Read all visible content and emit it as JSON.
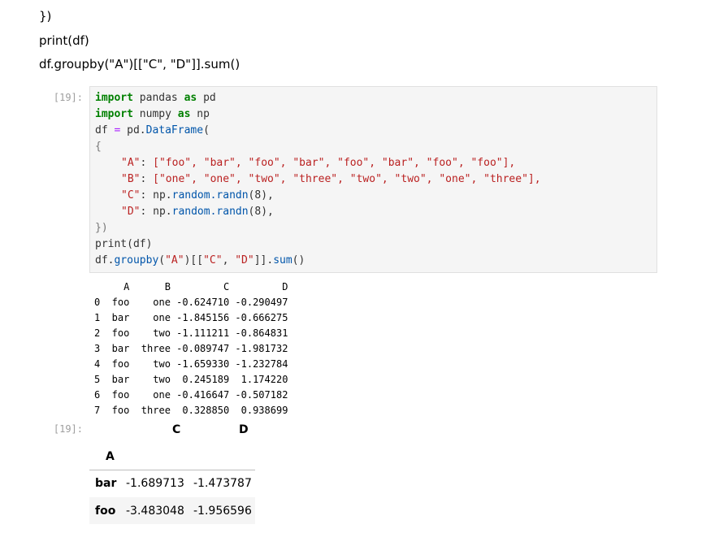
{
  "markdown_lines": [
    "})",
    "print(df)",
    "df.groupby(\"A\")[[\"C\", \"D\"]].sum()"
  ],
  "input_prompt": "[19]:",
  "output_prompt": "[19]:",
  "code": {
    "l1_kw1": "import",
    "l1_mid": " pandas ",
    "l1_kw2": "as",
    "l1_end": " pd",
    "l2_kw1": "import",
    "l2_mid": " numpy ",
    "l2_kw2": "as",
    "l2_end": " np",
    "l3_a": "df ",
    "l3_eq": "=",
    "l3_b": " pd.",
    "l3_fn": "DataFrame",
    "l3_c": "(",
    "l4": "{",
    "l5_key": "\"A\"",
    "l5_mid": ": ",
    "l5_val": "[\"foo\", \"bar\", \"foo\", \"bar\", \"foo\", \"bar\", \"foo\", \"foo\"],",
    "l6_key": "\"B\"",
    "l6_mid": ": ",
    "l6_val": "[\"one\", \"one\", \"two\", \"three\", \"two\", \"two\", \"one\", \"three\"],",
    "l7_key": "\"C\"",
    "l7_mid": ": np.",
    "l7_fn": "random.randn",
    "l7_end": "(8),",
    "l8_key": "\"D\"",
    "l8_mid": ": np.",
    "l8_fn": "random.randn",
    "l8_end": "(8),",
    "l9": "})",
    "l10": "print(df)",
    "l11_a": "df.",
    "l11_fn": "groupby",
    "l11_b": "(",
    "l11_str": "\"A\"",
    "l11_c": ")[[",
    "l11_s1": "\"C\"",
    "l11_d": ", ",
    "l11_s2": "\"D\"",
    "l11_e": "]].",
    "l11_fn2": "sum",
    "l11_f": "()"
  },
  "printed_df": {
    "header": "     A      B         C         D",
    "rows": [
      "0  foo    one -0.624710 -0.290497",
      "1  bar    one -1.845156 -0.666275",
      "2  foo    two -1.111211 -0.864831",
      "3  bar  three -0.089747 -1.981732",
      "4  foo    two -1.659330 -1.232784",
      "5  bar    two  0.245189  1.174220",
      "6  foo    one -0.416647 -0.507182",
      "7  foo  three  0.328850  0.938699"
    ]
  },
  "result_table": {
    "columns": [
      "C",
      "D"
    ],
    "index_name": "A",
    "rows": [
      {
        "index": "bar",
        "C": "-1.689713",
        "D": "-1.473787"
      },
      {
        "index": "foo",
        "C": "-3.483048",
        "D": "-1.956596"
      }
    ]
  }
}
